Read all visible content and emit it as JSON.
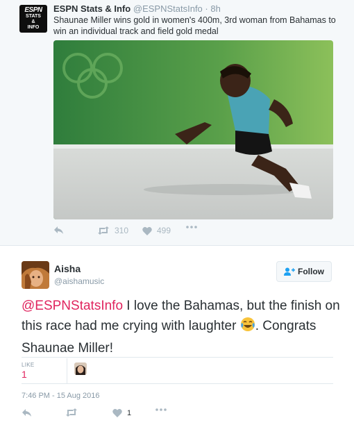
{
  "quoted_tweet": {
    "avatar": {
      "logo": "ESPN",
      "line1": "STATS",
      "line2": "&",
      "line3": "INFO"
    },
    "name": "ESPN Stats & Info",
    "handle": "@ESPNStatsInfo",
    "dot": "·",
    "time": "8h",
    "text": "Shaunae Miller wins gold in women's 400m, 3rd woman from Bahamas to win an individual track and field gold medal",
    "retweets": "310",
    "likes": "499"
  },
  "tweet": {
    "name": "Aisha",
    "handle": "@aishamusic",
    "follow_label": "Follow",
    "mention": "@ESPNStatsInfo",
    "text_part1": " I love the Bahamas, but the finish on this race had me crying with laughter ",
    "text_part2": ". Congrats Shaunae Miller!",
    "likes_label": "LIKE",
    "likes_count": "1",
    "timestamp": "7:46 PM - 15 Aug 2016",
    "action_like_count": "1"
  },
  "colors": {
    "accent": "#e0245e",
    "muted": "#8899a6",
    "icon": "#aab8c2",
    "text": "#292f33"
  }
}
